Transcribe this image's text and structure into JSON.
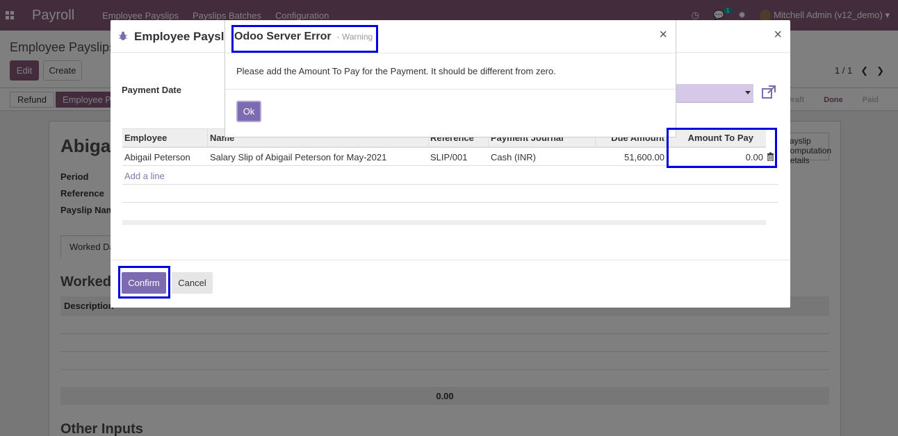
{
  "navbar": {
    "app_name": "Payroll",
    "menu": [
      "Employee Payslips",
      "Payslips Batches",
      "Configuration"
    ],
    "message_count": "1",
    "user": "Mitchell Admin (v12_demo)"
  },
  "control_panel": {
    "breadcrumb": "Employee Payslips",
    "edit_label": "Edit",
    "create_label": "Create",
    "pager": "1 / 1"
  },
  "statusbar": {
    "refund_label": "Refund",
    "employee_payment_label": "Employee Payment",
    "stages": [
      "Draft",
      "Done",
      "Paid"
    ],
    "active_stage": "Done"
  },
  "sheet": {
    "title": "Abigail Peterson",
    "labels": [
      "Period",
      "Reference",
      "Payslip Name"
    ],
    "tab": "Worked Days & Inputs",
    "section_worked": "Worked Days",
    "description_header": "Description",
    "total": "0.00",
    "section_other": "Other Inputs",
    "smart_button": "Payslip Computation Details"
  },
  "payment_dialog": {
    "title": "Employee Payslip Payment",
    "payment_date_label": "Payment Date",
    "columns": [
      "Employee",
      "Name",
      "Reference",
      "Payment Journal",
      "Due Amount",
      "Amount To Pay"
    ],
    "rows": [
      {
        "employee": "Abigail Peterson",
        "name": "Salary Slip of Abigail Peterson for May-2021",
        "reference": "SLIP/001",
        "journal": "Cash (INR)",
        "due_amount": "51,600.00",
        "amount_to_pay": "0.00"
      }
    ],
    "add_line_label": "Add a line",
    "confirm_label": "Confirm",
    "cancel_label": "Cancel",
    "close_symbol": "×"
  },
  "error_dialog": {
    "title": "Odoo Server Error",
    "subtitle": "- Warning",
    "message": "Please add the Amount To Pay for the Payment. It should be different from zero.",
    "ok_label": "Ok",
    "close_symbol": "×"
  },
  "colors": {
    "brand": "#875a7b",
    "primary_button": "#7c6bb0",
    "highlight_box": "#0000e0"
  }
}
